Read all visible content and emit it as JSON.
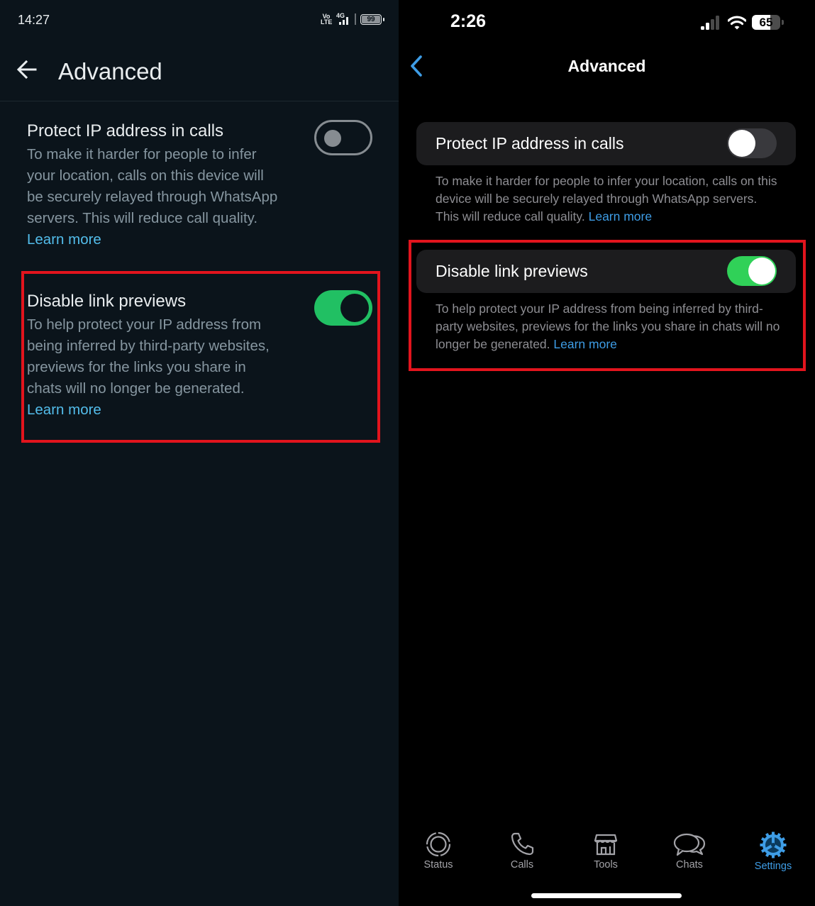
{
  "android": {
    "status_bar": {
      "time": "14:27",
      "volte_label": "Vo LTE",
      "network_label": "4G",
      "battery_percent": 99,
      "battery_label": "99"
    },
    "app_bar": {
      "back_icon": "arrow-left-icon",
      "title": "Advanced"
    },
    "settings": [
      {
        "title": "Protect IP address in calls",
        "description": "To make it harder for people to infer your location, calls on this device will be securely relayed through WhatsApp servers. This will reduce call quality.",
        "link": "Learn more",
        "enabled": false
      },
      {
        "title": "Disable link previews",
        "description": "To help protect your IP address from being inferred by third-party websites, previews for the links you share in chats will no longer be generated.",
        "link": "Learn more",
        "enabled": true,
        "highlighted": true
      }
    ],
    "colors": {
      "background": "#0b141b",
      "switch_on": "#21c063",
      "link": "#53bdeb",
      "highlight": "#e2141d"
    }
  },
  "ios": {
    "status_bar": {
      "time": "2:26",
      "signal_bars_active": 2,
      "signal_bars_total": 4,
      "battery_percent": 65,
      "battery_label": "65"
    },
    "nav_bar": {
      "back_icon": "chevron-left-icon",
      "title": "Advanced"
    },
    "settings": [
      {
        "title": "Protect IP address in calls",
        "description": "To make it harder for people to infer your location, calls on this device will be securely relayed through WhatsApp servers. This will reduce call quality.",
        "link": "Learn more",
        "enabled": false
      },
      {
        "title": "Disable link previews",
        "description": "To help protect your IP address from being inferred by third-party websites, previews for the links you share in chats will no longer be generated.",
        "link": "Learn more",
        "enabled": true,
        "highlighted": true
      }
    ],
    "tab_bar": [
      {
        "label": "Status",
        "icon": "status-icon",
        "active": false
      },
      {
        "label": "Calls",
        "icon": "phone-icon",
        "active": false
      },
      {
        "label": "Tools",
        "icon": "storefront-icon",
        "active": false
      },
      {
        "label": "Chats",
        "icon": "chat-bubbles-icon",
        "active": false
      },
      {
        "label": "Settings",
        "icon": "gear-icon",
        "active": true
      }
    ],
    "colors": {
      "background": "#000000",
      "cell": "#1c1c1e",
      "switch_on": "#30d158",
      "switch_off": "#39393d",
      "accent": "#3e9de6",
      "highlight": "#e2141d"
    }
  }
}
